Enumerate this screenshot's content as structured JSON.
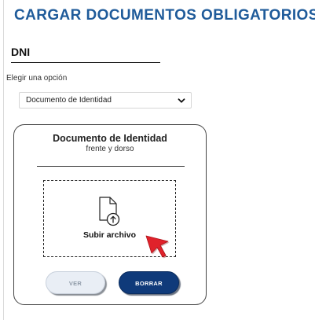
{
  "page": {
    "title": "CARGAR DOCUMENTOS OBLIGATORIOS"
  },
  "section": {
    "title": "DNI",
    "select_label": "Elegir una opción",
    "select_value": "Documento de Identidad"
  },
  "upload_card": {
    "title": "Documento de Identidad",
    "subtitle": "frente y dorso",
    "dropzone_label": "Subir archivo",
    "ver_button": "VER",
    "borrar_button": "BORRAR"
  },
  "icons": {
    "dropdown": "chevron-down-icon",
    "file_upload": "file-upload-icon",
    "cursor": "mouse-pointer-icon"
  },
  "colors": {
    "title": "#1f5b9a",
    "primary_button": "#0f3a7a",
    "disabled_button": "#e9eef5",
    "cursor": "#e0222b"
  }
}
